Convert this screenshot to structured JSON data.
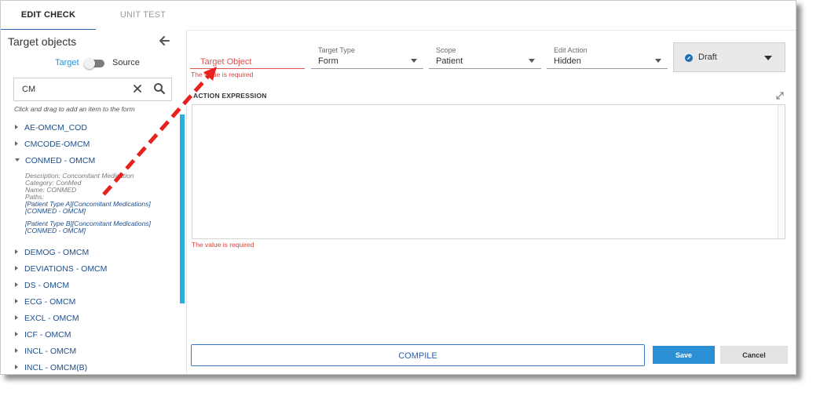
{
  "tabs": [
    {
      "label": "EDIT CHECK"
    },
    {
      "label": "UNIT TEST"
    }
  ],
  "left_panel": {
    "title": "Target objects",
    "toggle": {
      "left": "Target",
      "right": "Source"
    },
    "search": {
      "value": "CM"
    },
    "hint": "Click and drag to add an item to the form",
    "items": [
      {
        "label": "AE-OMCM_COD"
      },
      {
        "label": "CMCODE-OMCM"
      },
      {
        "label": "CONMED - OMCM"
      },
      {
        "label": "DEMOG - OMCM"
      },
      {
        "label": "DEVIATIONS - OMCM"
      },
      {
        "label": "DS - OMCM"
      },
      {
        "label": "ECG - OMCM"
      },
      {
        "label": "EXCL - OMCM"
      },
      {
        "label": "ICF - OMCM"
      },
      {
        "label": "INCL - OMCM"
      },
      {
        "label": "INCL - OMCM(B)"
      }
    ],
    "expanded": {
      "description": "Description: Concomitant Medication",
      "category": "Category: ConMed",
      "name": "Name: CONMED",
      "paths_label": "Paths:",
      "paths": [
        {
          "line1": "[Patient Type A][Concomitant Medications]",
          "line2": "[CONMED - OMCM]"
        },
        {
          "line1": "[Patient Type B][Concomitant Medications]",
          "line2": "[CONMED - OMCM]"
        }
      ]
    }
  },
  "form": {
    "target_object": {
      "placeholder": "Target Object",
      "error": "The value is required"
    },
    "target_type": {
      "label": "Target Type",
      "value": "Form"
    },
    "scope": {
      "label": "Scope",
      "value": "Patient"
    },
    "edit_action": {
      "label": "Edit Action",
      "value": "Hidden"
    },
    "status": {
      "value": "Draft"
    },
    "expression": {
      "label": "ACTION EXPRESSION",
      "error": "The value is required"
    },
    "compile_label": "COMPILE",
    "save_label": "Save",
    "cancel_label": "Cancel"
  },
  "colors": {
    "accent": "#2b8fd6",
    "link": "#1f4f8c",
    "error": "#d64541",
    "scroll": "#2aaedc",
    "annotation": "#e8201e"
  },
  "annotation": {
    "type": "dashed-arrow",
    "meaning": "drag CONMED - OMCM to Target Object"
  }
}
